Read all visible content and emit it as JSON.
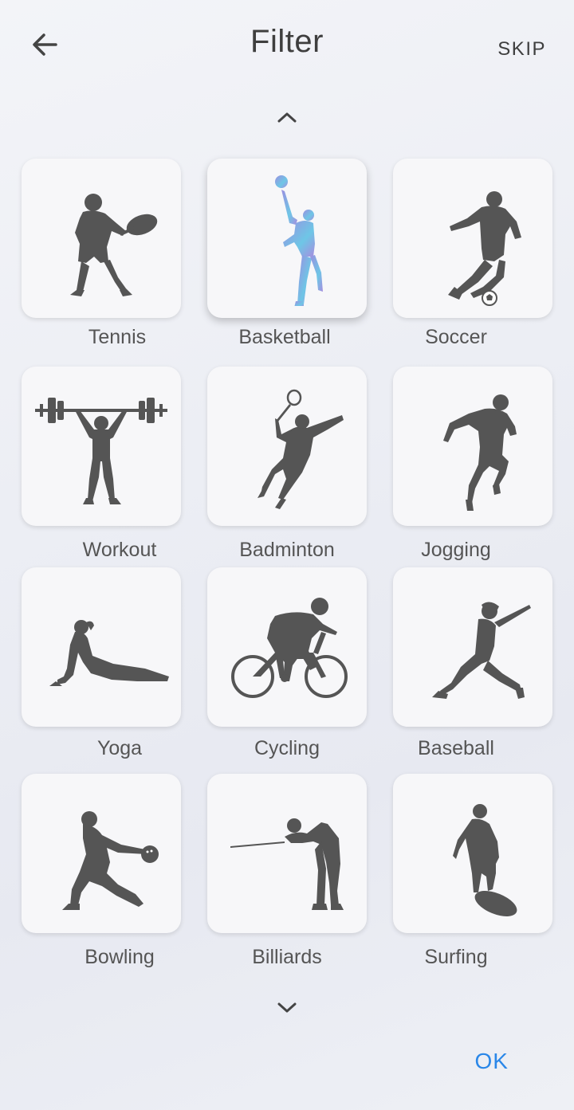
{
  "header": {
    "title": "Filter",
    "skip_label": "SKIP",
    "back_icon": "arrow-left-icon"
  },
  "navigation": {
    "up_icon": "chevron-up-icon",
    "down_icon": "chevron-down-icon"
  },
  "sports": [
    {
      "label": "Tennis",
      "icon": "tennis-icon",
      "selected": false
    },
    {
      "label": "Basketball",
      "icon": "basketball-icon",
      "selected": true
    },
    {
      "label": "Soccer",
      "icon": "soccer-icon",
      "selected": false
    },
    {
      "label": "Workout",
      "icon": "workout-icon",
      "selected": false
    },
    {
      "label": "Badminton",
      "icon": "badminton-icon",
      "selected": false
    },
    {
      "label": "Jogging",
      "icon": "jogging-icon",
      "selected": false
    },
    {
      "label": "Yoga",
      "icon": "yoga-icon",
      "selected": false
    },
    {
      "label": "Cycling",
      "icon": "cycling-icon",
      "selected": false
    },
    {
      "label": "Baseball",
      "icon": "baseball-icon",
      "selected": false
    },
    {
      "label": "Bowling",
      "icon": "bowling-icon",
      "selected": false
    },
    {
      "label": "Billiards",
      "icon": "billiards-icon",
      "selected": false
    },
    {
      "label": "Surfing",
      "icon": "surfing-icon",
      "selected": false
    }
  ],
  "footer": {
    "ok_label": "OK"
  },
  "colors": {
    "accent": "#2a87e8",
    "silhouette": "#555555",
    "selected_gradient_start": "#9b8fe0",
    "selected_gradient_end": "#6ec6e6"
  }
}
